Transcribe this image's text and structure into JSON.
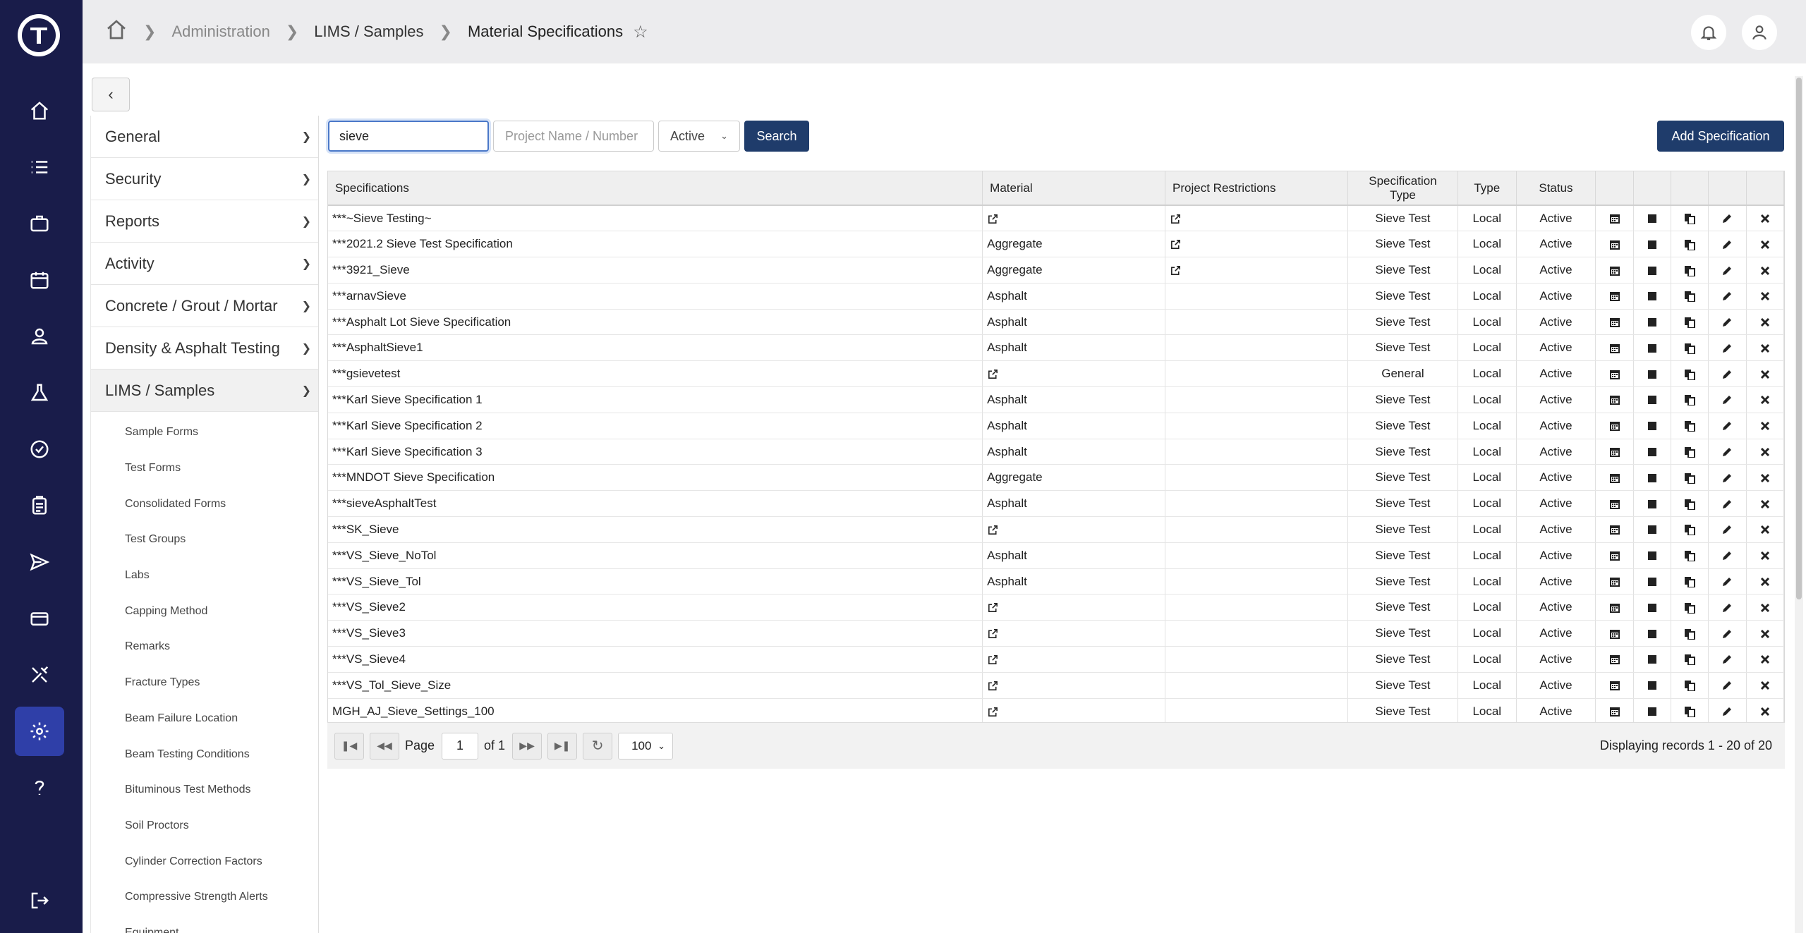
{
  "breadcrumb": {
    "items": [
      "Administration",
      "LIMS / Samples",
      "Material Specifications"
    ]
  },
  "search": {
    "value": "sieve",
    "project_placeholder": "Project Name / Number",
    "status_value": "Active",
    "search_label": "Search",
    "add_label": "Add Specification"
  },
  "sidebar": {
    "sections": [
      "General",
      "Security",
      "Reports",
      "Activity",
      "Concrete / Grout / Mortar",
      "Density & Asphalt Testing",
      "LIMS / Samples"
    ],
    "sub_items": [
      "Sample Forms",
      "Test Forms",
      "Consolidated Forms",
      "Test Groups",
      "Labs",
      "Capping Method",
      "Remarks",
      "Fracture Types",
      "Beam Failure Location",
      "Beam Testing Conditions",
      "Bituminous Test Methods",
      "Soil Proctors",
      "Cylinder Correction Factors",
      "Compressive Strength Alerts",
      "Equipment"
    ]
  },
  "table": {
    "headers": [
      "Specifications",
      "Material",
      "Project Restrictions",
      "Specification Type",
      "Type",
      "Status"
    ],
    "rows": [
      {
        "spec": "***~Sieve Testing~",
        "material": "",
        "material_link": true,
        "proj_link": true,
        "spec_type": "Sieve Test",
        "type": "Local",
        "status": "Active"
      },
      {
        "spec": "***2021.2 Sieve Test Specification",
        "material": "Aggregate",
        "material_link": false,
        "proj_link": true,
        "spec_type": "Sieve Test",
        "type": "Local",
        "status": "Active"
      },
      {
        "spec": "***3921_Sieve",
        "material": "Aggregate",
        "material_link": false,
        "proj_link": true,
        "spec_type": "Sieve Test",
        "type": "Local",
        "status": "Active"
      },
      {
        "spec": "***arnavSieve",
        "material": "Asphalt",
        "material_link": false,
        "proj_link": false,
        "spec_type": "Sieve Test",
        "type": "Local",
        "status": "Active"
      },
      {
        "spec": "***Asphalt Lot Sieve Specification",
        "material": "Asphalt",
        "material_link": false,
        "proj_link": false,
        "spec_type": "Sieve Test",
        "type": "Local",
        "status": "Active"
      },
      {
        "spec": "***AsphaltSieve1",
        "material": "Asphalt",
        "material_link": false,
        "proj_link": false,
        "spec_type": "Sieve Test",
        "type": "Local",
        "status": "Active"
      },
      {
        "spec": "***gsievetest",
        "material": "",
        "material_link": true,
        "proj_link": false,
        "spec_type": "General",
        "type": "Local",
        "status": "Active"
      },
      {
        "spec": "***Karl Sieve Specification 1",
        "material": "Asphalt",
        "material_link": false,
        "proj_link": false,
        "spec_type": "Sieve Test",
        "type": "Local",
        "status": "Active"
      },
      {
        "spec": "***Karl Sieve Specification 2",
        "material": "Asphalt",
        "material_link": false,
        "proj_link": false,
        "spec_type": "Sieve Test",
        "type": "Local",
        "status": "Active"
      },
      {
        "spec": "***Karl Sieve Specification 3",
        "material": "Asphalt",
        "material_link": false,
        "proj_link": false,
        "spec_type": "Sieve Test",
        "type": "Local",
        "status": "Active"
      },
      {
        "spec": "***MNDOT Sieve Specification",
        "material": "Aggregate",
        "material_link": false,
        "proj_link": false,
        "spec_type": "Sieve Test",
        "type": "Local",
        "status": "Active"
      },
      {
        "spec": "***sieveAsphaltTest",
        "material": "Asphalt",
        "material_link": false,
        "proj_link": false,
        "spec_type": "Sieve Test",
        "type": "Local",
        "status": "Active"
      },
      {
        "spec": "***SK_Sieve",
        "material": "",
        "material_link": true,
        "proj_link": false,
        "spec_type": "Sieve Test",
        "type": "Local",
        "status": "Active"
      },
      {
        "spec": "***VS_Sieve_NoTol",
        "material": "Asphalt",
        "material_link": false,
        "proj_link": false,
        "spec_type": "Sieve Test",
        "type": "Local",
        "status": "Active"
      },
      {
        "spec": "***VS_Sieve_Tol",
        "material": "Asphalt",
        "material_link": false,
        "proj_link": false,
        "spec_type": "Sieve Test",
        "type": "Local",
        "status": "Active"
      },
      {
        "spec": "***VS_Sieve2",
        "material": "",
        "material_link": true,
        "proj_link": false,
        "spec_type": "Sieve Test",
        "type": "Local",
        "status": "Active"
      },
      {
        "spec": "***VS_Sieve3",
        "material": "",
        "material_link": true,
        "proj_link": false,
        "spec_type": "Sieve Test",
        "type": "Local",
        "status": "Active"
      },
      {
        "spec": "***VS_Sieve4",
        "material": "",
        "material_link": true,
        "proj_link": false,
        "spec_type": "Sieve Test",
        "type": "Local",
        "status": "Active"
      },
      {
        "spec": "***VS_Tol_Sieve_Size",
        "material": "",
        "material_link": true,
        "proj_link": false,
        "spec_type": "Sieve Test",
        "type": "Local",
        "status": "Active"
      },
      {
        "spec": "MGH_AJ_Sieve_Settings_100",
        "material": "",
        "material_link": true,
        "proj_link": false,
        "spec_type": "Sieve Test",
        "type": "Local",
        "status": "Active"
      }
    ]
  },
  "pager": {
    "page_label": "Page",
    "page_value": "1",
    "of_label": "of 1",
    "page_size": "100",
    "records": "Displaying records  1 - 20  of  20"
  },
  "colors": {
    "rail": "#191c4a",
    "rail_active": "#2f3fa8",
    "primary_button": "#1f3c6b"
  }
}
